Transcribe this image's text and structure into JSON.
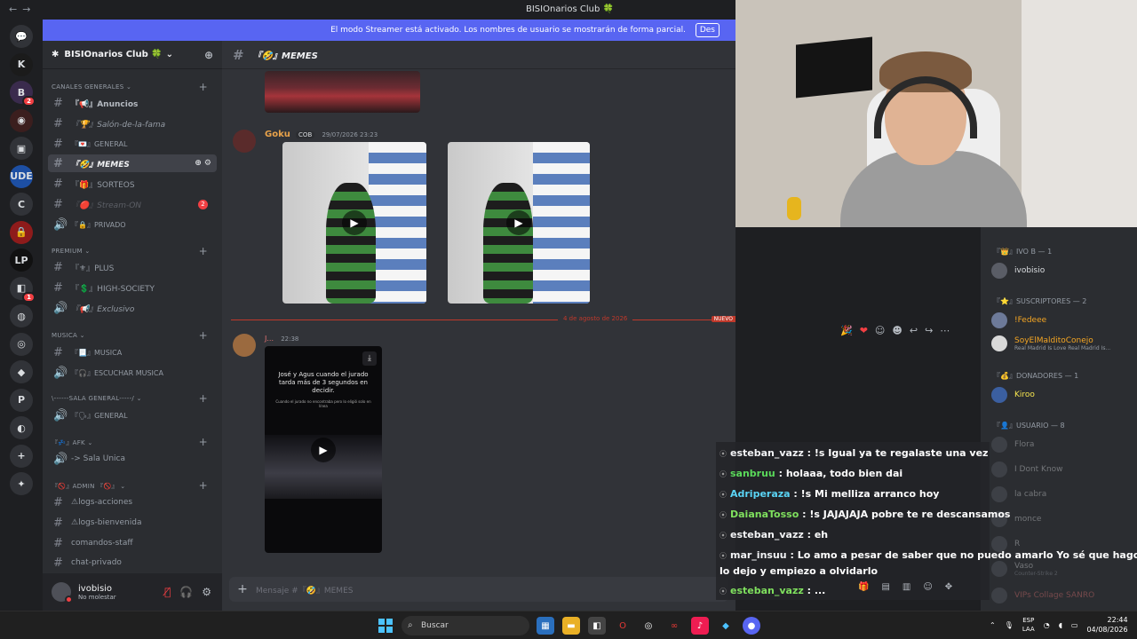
{
  "window": {
    "title": "BISIOnarios Club 🍀"
  },
  "banner": {
    "text": "El modo Streamer está activado. Los nombres de usuario se mostrarán de forma parcial.",
    "button": "Des"
  },
  "server": {
    "name": "BISIOnarios Club 🍀"
  },
  "guilds": [
    {
      "label": "💬",
      "bg": "#313338"
    },
    {
      "label": "K",
      "bg": "#1b1b1b"
    },
    {
      "label": "B",
      "bg": "#3a2b4d",
      "badge": "2"
    },
    {
      "label": "◉",
      "bg": "#3b1e1e"
    },
    {
      "label": "▣",
      "bg": "#313338"
    },
    {
      "label": "UDE",
      "bg": "#1d4fa3"
    },
    {
      "label": "C",
      "bg": "#313338"
    },
    {
      "label": "🔒",
      "bg": "#8e1b1b"
    },
    {
      "label": "LP",
      "bg": "#111"
    },
    {
      "label": "◧",
      "bg": "#313338",
      "badge": "1"
    },
    {
      "label": "◍",
      "bg": "#313338"
    },
    {
      "label": "◎",
      "bg": "#313338"
    },
    {
      "label": "◆",
      "bg": "#313338"
    },
    {
      "label": "P",
      "bg": "#313338"
    },
    {
      "label": "◐",
      "bg": "#313338"
    },
    {
      "label": "+",
      "bg": "#313338"
    },
    {
      "label": "✦",
      "bg": "#313338"
    }
  ],
  "categories": {
    "general": "CANALES GENERALES",
    "premium": "PREMIUM",
    "musica": "MUSICA",
    "sala": "\\------SALA GENERAL-----/",
    "afk": "『💤』AFK",
    "admin": "『🚫』ADMIN 『🚫』"
  },
  "channels": {
    "anuncios": "『📢』Anuncios",
    "salon": "『🏆』Salón-de-la-fama",
    "general": "『💌』GENERAL",
    "memes": "『🤣』MEMES",
    "sorteos": "『🎁』SORTEOS",
    "stream": "『🔴』Stream-ON",
    "stream_badge": "2",
    "privado": "『🔒』PRIVADO",
    "plus": "『⚜』PLUS",
    "high": "『💲』HIGH-SOCIETY",
    "exclusivo": "『📢』Exclusivo",
    "musica": "『📃』MUSICA",
    "escuchar": "『🎧』ESCUCHAR MUSICA",
    "general_voice": "『🗣』GENERAL",
    "sala_unica": "-> Sala Unica",
    "logs_acciones": "⚠logs-acciones",
    "logs_bienvenida": "⚠logs-bienvenida",
    "comandos": "comandos-staff",
    "chat_privado": "chat-privado"
  },
  "header": {
    "channel": "『🤣』MEMES"
  },
  "messages": {
    "goku_name": "Goku",
    "goku_tag": "COB",
    "goku_time": "29/07/2026 23:23",
    "divider_date": "4 de agosto de 2026",
    "new_label": "NUEVO",
    "second_name": "J...",
    "second_time": "22:38",
    "phone_text": "José y Agus cuando el jurado tarda más de 3 segundos en decidir.",
    "phone_sub": "Cuando el jurado no encontraba pero lo eligió solo en línea"
  },
  "composer": {
    "placeholder": "Mensaje #『🤣』MEMES"
  },
  "user": {
    "name": "ivobisio",
    "status": "No molestar"
  },
  "members": {
    "cat_ivo": "『👑』IVO B — 1",
    "m_ivo": "ivobisio",
    "cat_sus": "『⭐』SUSCRIPTORES — 2",
    "m_fedeee": "!Fedeee",
    "m_conejo": "SoyElMalditoConejo",
    "m_conejo_sub": "Real Madrid Is Love Real Madrid Is...",
    "cat_don": "『💰』DONADORES — 1",
    "m_kiroo": "Kiroo",
    "cat_usu": "『👤』USUARIO — 8",
    "m_flora": "Flora",
    "m_idk": "I Dont Know",
    "m_cabra": "la cabra",
    "m_monce": "monce",
    "m_r": "R",
    "m_vaso": "Vaso",
    "m_vaso_sub": "Counter-Strike 2",
    "m_vips": "VIPs Collage SANRO"
  },
  "chat": [
    {
      "user": "esteban_vazz",
      "color": "#f2f3f5",
      "msg": "!s Igual ya te regalaste una vez"
    },
    {
      "user": "sanbruu",
      "color": "#5ad95a",
      "msg": "holaaa, todo bien dai"
    },
    {
      "user": "Adriperaza",
      "color": "#5ad4f5",
      "msg": "!s Mi melliza arranco hoy"
    },
    {
      "user": "DaianaTosso",
      "color": "#7fe05e",
      "msg": "!s JAJAJAJA pobre te re descansamos"
    },
    {
      "user": "esteban_vazz",
      "color": "#f2f3f5",
      "msg": "eh"
    },
    {
      "user": "mar_insuu",
      "color": "#f2f3f5",
      "msg": "Lo amo a pesar de saber que no puedo amarlo Yo sé que hago bien si"
    },
    {
      "user": "",
      "color": "#f2f3f5",
      "msg": "lo dejo y empiezo a olvidarlo"
    },
    {
      "user": "esteban_vazz",
      "color": "#7fe05e",
      "msg": "..."
    }
  ],
  "taskbar": {
    "search": "Buscar",
    "lang1": "ESP",
    "lang2": "LAA",
    "time": "22:44",
    "date": "04/08/2026"
  },
  "colors": {
    "accent": "#5865f2",
    "danger": "#f23f43",
    "online": "#23a559"
  }
}
